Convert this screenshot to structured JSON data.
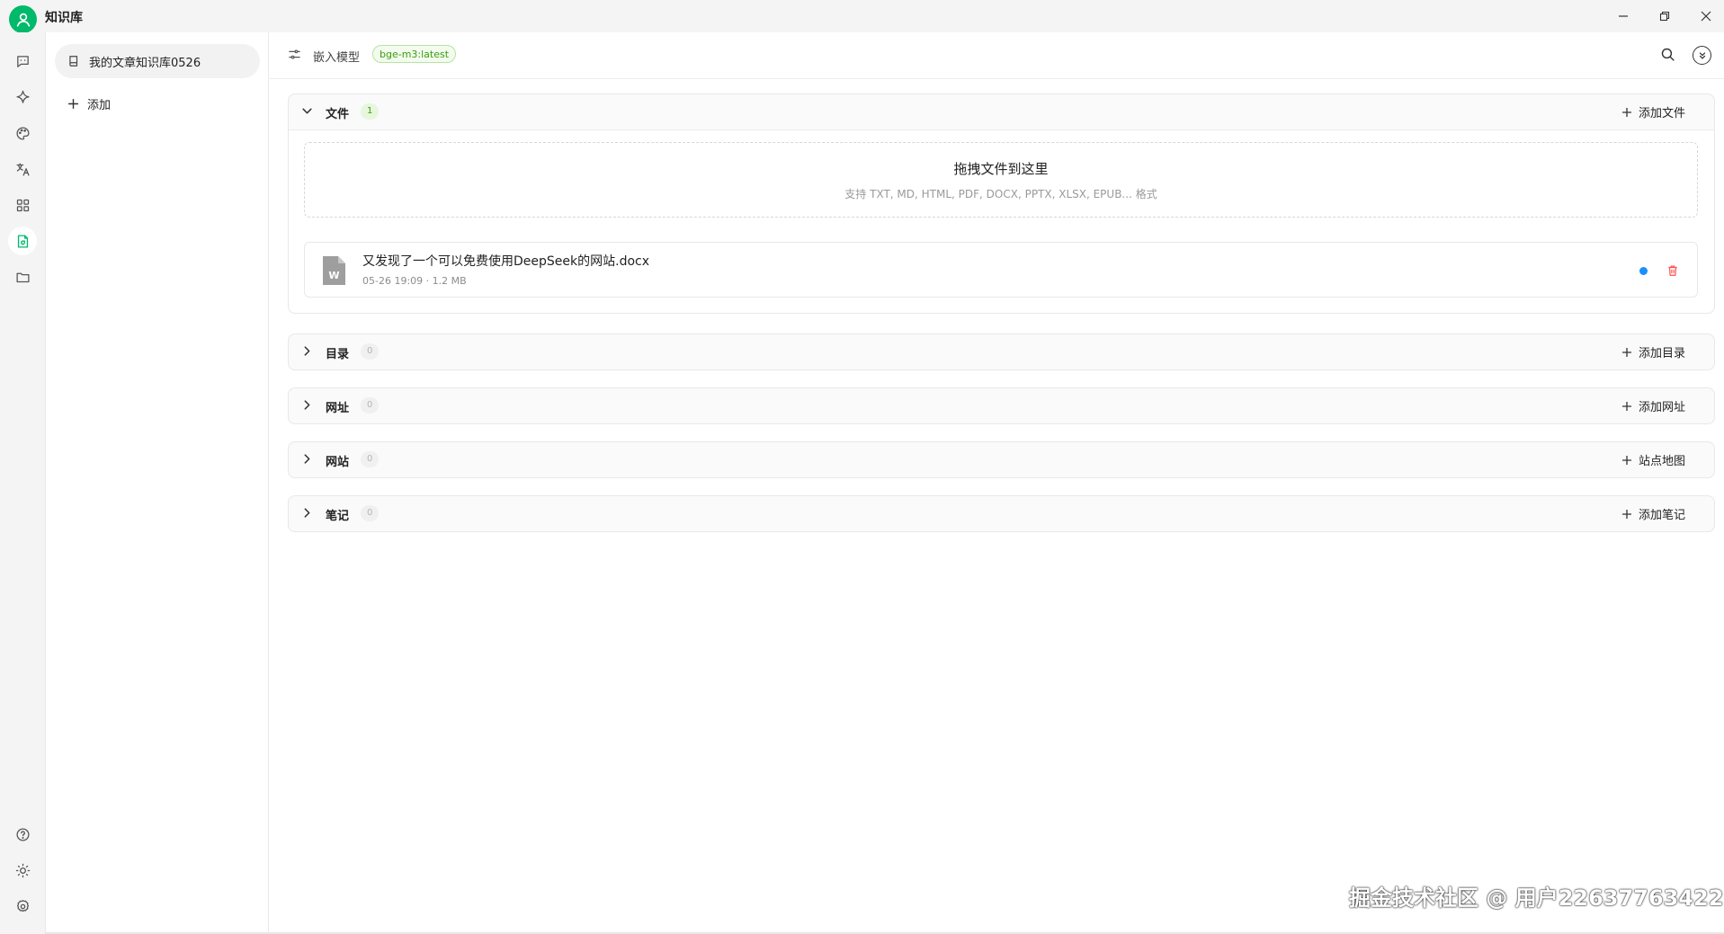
{
  "app": {
    "title": "知识库"
  },
  "colors": {
    "accent": "#00b96b",
    "tag_green": "#389e0d",
    "status_blue": "#1890ff",
    "delete_red": "#ff4d4f"
  },
  "window_controls": [
    "minimize-icon",
    "restore-icon",
    "close-icon"
  ],
  "iconbar": {
    "top": [
      {
        "name": "chat-icon"
      },
      {
        "name": "sparkle-icon"
      },
      {
        "name": "palette-icon"
      },
      {
        "name": "translate-icon"
      },
      {
        "name": "apps-grid-icon"
      },
      {
        "name": "knowledge-base-icon",
        "active": true
      },
      {
        "name": "folder-icon"
      }
    ],
    "bottom": [
      {
        "name": "help-icon"
      },
      {
        "name": "theme-icon"
      },
      {
        "name": "settings-icon"
      }
    ]
  },
  "kb_list": {
    "items": [
      {
        "label": "我的文章知识库0526",
        "active": true
      }
    ],
    "add_label": "添加"
  },
  "topbar": {
    "embed_label": "嵌入模型",
    "model_tag": "bge-m3:latest"
  },
  "sections": {
    "files": {
      "title": "文件",
      "count": "1",
      "action_label": "添加文件",
      "dropzone_title": "拖拽文件到这里",
      "dropzone_hint": "支持 TXT, MD, HTML, PDF, DOCX, PPTX, XLSX, EPUB... 格式",
      "items": [
        {
          "name": "又发现了一个可以免费使用DeepSeek的网站.docx",
          "meta": "05-26 19:09 · 1.2 MB",
          "status": "processing"
        }
      ]
    },
    "directory": {
      "title": "目录",
      "count": "0",
      "action_label": "添加目录"
    },
    "url": {
      "title": "网址",
      "count": "0",
      "action_label": "添加网址"
    },
    "website": {
      "title": "网站",
      "count": "0",
      "action_label": "站点地图"
    },
    "notes": {
      "title": "笔记",
      "count": "0",
      "action_label": "添加笔记"
    }
  },
  "watermark": "掘金技术社区 @ 用户22637763422"
}
